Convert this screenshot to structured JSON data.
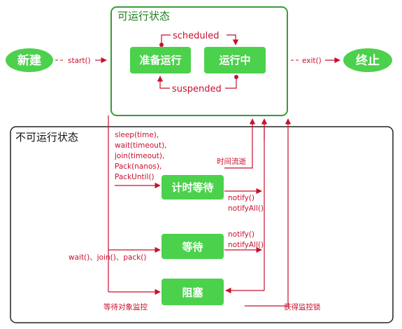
{
  "regions": {
    "runnable_title": "可运行状态",
    "not_runnable_title": "不可运行状态"
  },
  "states": {
    "new": "新建",
    "ready": "准备运行",
    "running": "运行中",
    "terminated": "终止",
    "timed_waiting": "计时等待",
    "waiting": "等待",
    "blocked": "阻塞"
  },
  "transitions": {
    "start": "start()",
    "exit": "exit()",
    "scheduled": "scheduled",
    "suspended": "suspended",
    "sleep_group": [
      "sleep(time),",
      "wait(timeout),",
      "join(timeout),",
      "Pack(nanos),",
      "PackUntil()"
    ],
    "time_elapsed": "时间流逝",
    "notify_timed": [
      "notify()",
      "notifyAll()"
    ],
    "notify_wait": [
      "notify()",
      "notifyAll()"
    ],
    "wait_join_pack": "wait()、join()、pack()",
    "wait_monitor": "等待对象监控",
    "acquire_lock": "获得监控锁"
  },
  "colors": {
    "green_fill": "#4cd14c",
    "green_border": "#3a9a3a",
    "arrow_red": "#c8102e",
    "box_black": "#222222"
  }
}
